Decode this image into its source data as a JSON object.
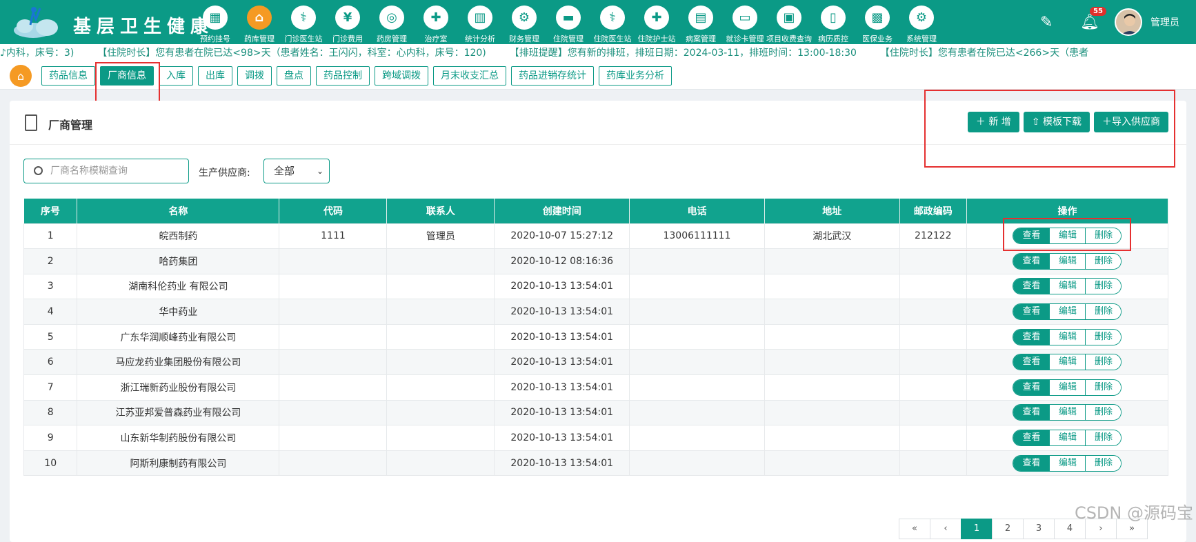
{
  "app": {
    "name": "基层卫生健康"
  },
  "nav": [
    {
      "label": "预约挂号",
      "icon": "calendar-icon"
    },
    {
      "label": "药库管理",
      "icon": "pharmacy-store-icon"
    },
    {
      "label": "门诊医生站",
      "icon": "doctor-icon"
    },
    {
      "label": "门诊费用",
      "icon": "yuan-icon"
    },
    {
      "label": "药房管理",
      "icon": "pill-icon"
    },
    {
      "label": "治疗室",
      "icon": "treatment-icon"
    },
    {
      "label": "统计分析",
      "icon": "bar-chart-icon"
    },
    {
      "label": "财务管理",
      "icon": "finance-gear-icon"
    },
    {
      "label": "住院管理",
      "icon": "bed-icon"
    },
    {
      "label": "住院医生站",
      "icon": "inpatient-doctor-icon"
    },
    {
      "label": "住院护士站",
      "icon": "nurse-icon"
    },
    {
      "label": "病案管理",
      "icon": "medical-record-icon"
    },
    {
      "label": "就诊卡管理",
      "icon": "card-icon"
    },
    {
      "label": "项目收费查询",
      "icon": "fee-query-icon"
    },
    {
      "label": "病历质控",
      "icon": "record-quality-icon"
    },
    {
      "label": "医保业务",
      "icon": "insurance-icon"
    },
    {
      "label": "系统管理",
      "icon": "settings-icon"
    }
  ],
  "header": {
    "notification_count": "55",
    "user": "管理员"
  },
  "marquee": [
    "♪内科，床号：3)",
    "【住院时长】您有患者在院已达<98>天（患者姓名：王闪闪，科室：心内科，床号：120)",
    "【排班提醒】您有新的排班，排班日期：2024-03-11，排班时间：13:00-18:30",
    "【住院时长】您有患者在院已达<266>天（患者"
  ],
  "tabs": [
    "药品信息",
    "厂商信息",
    "入库",
    "出库",
    "调拨",
    "盘点",
    "药品控制",
    "跨域调拨",
    "月末收支汇总",
    "药品进销存统计",
    "药库业务分析"
  ],
  "panel": {
    "title": "厂商管理",
    "buttons": {
      "add": "新 增",
      "template": "模板下载",
      "import": "导入供应商"
    },
    "search_placeholder": "厂商名称模糊查询",
    "filter_label": "生产供应商:",
    "filter_value": "全部"
  },
  "table": {
    "headers": [
      "序号",
      "名称",
      "代码",
      "联系人",
      "创建时间",
      "电话",
      "地址",
      "邮政编码",
      "操作"
    ],
    "ops": [
      "查看",
      "编辑",
      "删除"
    ],
    "rows": [
      [
        "1",
        "皖西制药",
        "1111",
        "管理员",
        "2020-10-07 15:27:12",
        "13006111111",
        "湖北武汉",
        "212122"
      ],
      [
        "2",
        "哈药集团",
        "",
        "",
        "2020-10-12 08:16:36",
        "",
        "",
        ""
      ],
      [
        "3",
        "湖南科伦药业 有限公司",
        "",
        "",
        "2020-10-13 13:54:01",
        "",
        "",
        ""
      ],
      [
        "4",
        "华中药业",
        "",
        "",
        "2020-10-13 13:54:01",
        "",
        "",
        ""
      ],
      [
        "5",
        "广东华润顺峰药业有限公司",
        "",
        "",
        "2020-10-13 13:54:01",
        "",
        "",
        ""
      ],
      [
        "6",
        "马应龙药业集团股份有限公司",
        "",
        "",
        "2020-10-13 13:54:01",
        "",
        "",
        ""
      ],
      [
        "7",
        "浙江瑞新药业股份有限公司",
        "",
        "",
        "2020-10-13 13:54:01",
        "",
        "",
        ""
      ],
      [
        "8",
        "江苏亚邦爱普森药业有限公司",
        "",
        "",
        "2020-10-13 13:54:01",
        "",
        "",
        ""
      ],
      [
        "9",
        "山东新华制药股份有限公司",
        "",
        "",
        "2020-10-13 13:54:01",
        "",
        "",
        ""
      ],
      [
        "10",
        "阿斯利康制药有限公司",
        "",
        "",
        "2020-10-13 13:54:01",
        "",
        "",
        ""
      ]
    ]
  },
  "pager": [
    "«",
    "‹",
    "1",
    "2",
    "3",
    "4",
    "›",
    "»"
  ],
  "watermark": "CSDN @源码宝",
  "colors": {
    "primary": "#0b9a86",
    "accent": "#f59a23",
    "highlight": "#e53030"
  }
}
